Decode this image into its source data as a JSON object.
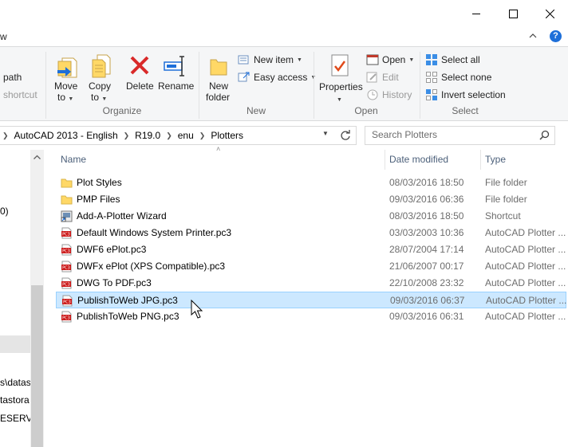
{
  "window": {
    "controls": {
      "minimize": "minimize",
      "maximize": "maximize",
      "close": "close"
    }
  },
  "tabs": {
    "partial_left": "w"
  },
  "ribbon": {
    "partial": {
      "path": "path",
      "shortcut": "shortcut"
    },
    "organize": {
      "label": "Organize",
      "move_to": [
        "Move",
        "to"
      ],
      "copy_to": [
        "Copy",
        "to"
      ],
      "delete": "Delete",
      "rename": "Rename"
    },
    "new": {
      "label": "New",
      "new_folder": [
        "New",
        "folder"
      ],
      "new_item": "New item",
      "easy_access": "Easy access"
    },
    "open": {
      "label": "Open",
      "properties": "Properties",
      "open": "Open",
      "edit": "Edit",
      "history": "History"
    },
    "select": {
      "label": "Select",
      "select_all": "Select all",
      "select_none": "Select none",
      "invert_selection": "Invert selection"
    }
  },
  "address": {
    "crumbs": [
      "AutoCAD 2013 - English",
      "R19.0",
      "enu",
      "Plotters"
    ],
    "search_placeholder": "Search Plotters"
  },
  "nav_partial": [
    "0)",
    "s\\datas",
    "tastora",
    "ESERVE"
  ],
  "columns": {
    "name": "Name",
    "date": "Date modified",
    "type": "Type"
  },
  "files": [
    {
      "name": "Plot Styles",
      "date": "08/03/2016 18:50",
      "type": "File folder",
      "icon": "folder-icon"
    },
    {
      "name": "PMP Files",
      "date": "09/03/2016 06:36",
      "type": "File folder",
      "icon": "folder-icon"
    },
    {
      "name": "Add-A-Plotter Wizard",
      "date": "08/03/2016 18:50",
      "type": "Shortcut",
      "icon": "shortcut-icon"
    },
    {
      "name": "Default Windows System Printer.pc3",
      "date": "03/03/2003 10:36",
      "type": "AutoCAD Plotter ...",
      "icon": "pc3-icon"
    },
    {
      "name": "DWF6 ePlot.pc3",
      "date": "28/07/2004 17:14",
      "type": "AutoCAD Plotter ...",
      "icon": "pc3-icon"
    },
    {
      "name": "DWFx ePlot (XPS Compatible).pc3",
      "date": "21/06/2007 00:17",
      "type": "AutoCAD Plotter ...",
      "icon": "pc3-icon"
    },
    {
      "name": "DWG To PDF.pc3",
      "date": "22/10/2008 23:32",
      "type": "AutoCAD Plotter ...",
      "icon": "pc3-icon"
    },
    {
      "name": "PublishToWeb JPG.pc3",
      "date": "09/03/2016 06:37",
      "type": "AutoCAD Plotter ...",
      "icon": "pc3-icon"
    },
    {
      "name": "PublishToWeb PNG.pc3",
      "date": "09/03/2016 06:31",
      "type": "AutoCAD Plotter ...",
      "icon": "pc3-icon"
    }
  ],
  "selected_index": 7,
  "colors": {
    "selection_bg": "#cce8ff",
    "selection_border": "#99d1ff",
    "folder": "#ffd866",
    "pc3_red": "#cc1a1a",
    "delete_red": "#d92a2a",
    "help_blue": "#1e6fd9"
  }
}
